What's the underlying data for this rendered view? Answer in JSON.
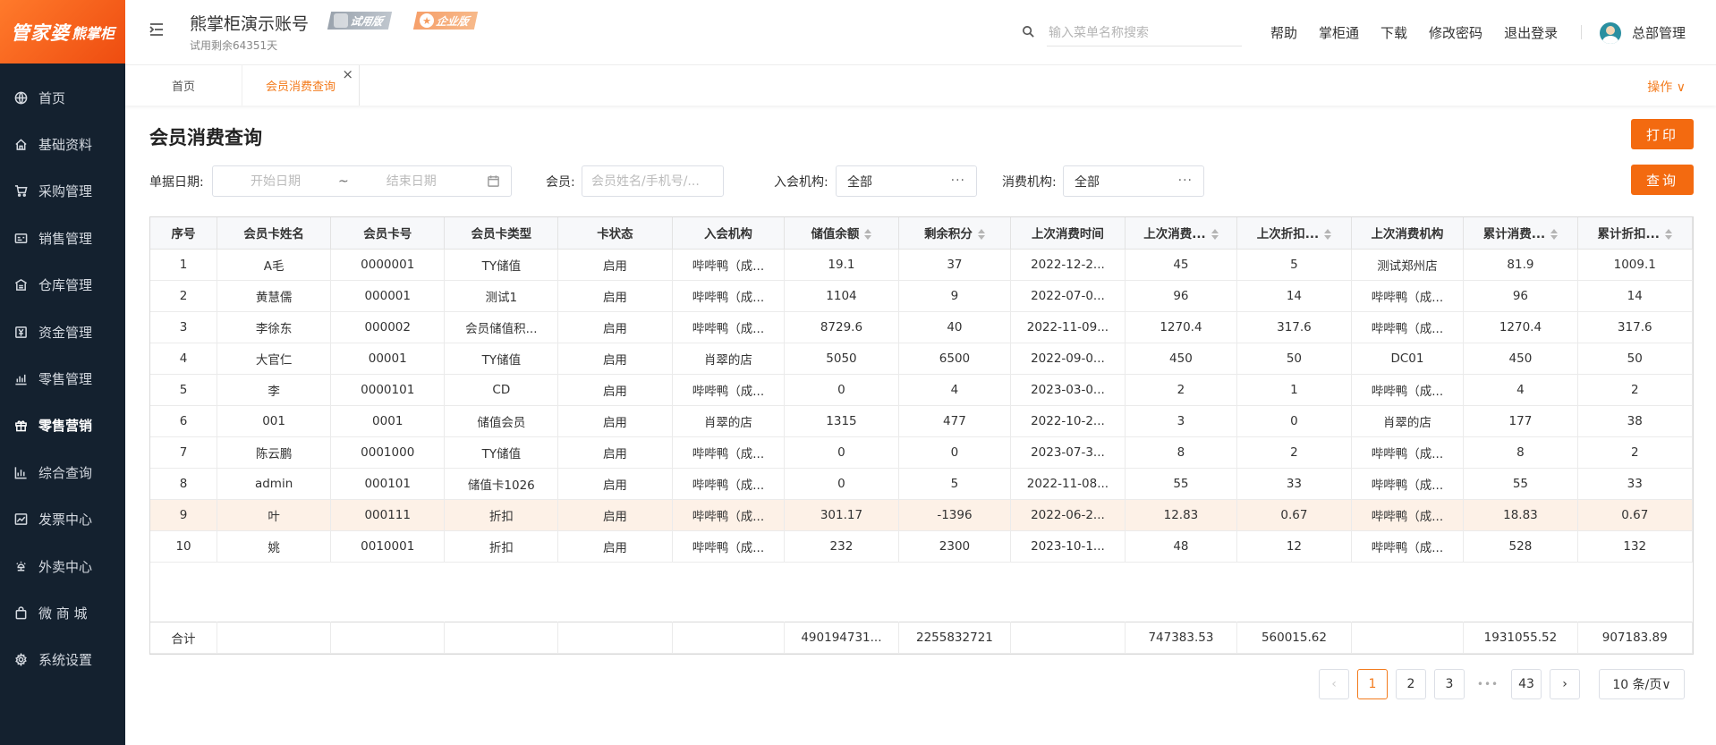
{
  "brand": {
    "logo_main": "管家婆",
    "logo_sub": "熊掌柜"
  },
  "sidebar": {
    "items": [
      {
        "label": "首页",
        "icon": "globe-icon"
      },
      {
        "label": "基础资料",
        "icon": "home-icon"
      },
      {
        "label": "采购管理",
        "icon": "cart-icon"
      },
      {
        "label": "销售管理",
        "icon": "sales-icon"
      },
      {
        "label": "仓库管理",
        "icon": "warehouse-icon"
      },
      {
        "label": "资金管理",
        "icon": "money-icon"
      },
      {
        "label": "零售管理",
        "icon": "chart-icon"
      },
      {
        "label": "零售营销",
        "icon": "gift-icon"
      },
      {
        "label": "综合查询",
        "icon": "bar-chart-icon"
      },
      {
        "label": "发票中心",
        "icon": "trend-icon"
      },
      {
        "label": "外卖中心",
        "icon": "delivery-icon"
      },
      {
        "label": "微 商 城",
        "icon": "shop-icon"
      },
      {
        "label": "系统设置",
        "icon": "gear-icon"
      }
    ]
  },
  "header": {
    "account_name": "熊掌柜演示账号",
    "badge_trial": "试用版",
    "badge_enterprise": "企业版",
    "trial_left": "试用剩余64351天",
    "search_placeholder": "输入菜单名称搜索",
    "links": [
      "帮助",
      "掌柜通",
      "下载",
      "修改密码",
      "退出登录"
    ],
    "user_name": "总部管理"
  },
  "tabs": {
    "home": "首页",
    "active": "会员消费查询",
    "ops": "操作 ∨"
  },
  "page": {
    "title": "会员消费查询",
    "print_label": "打印",
    "query_label": "查询",
    "filters": {
      "date_label": "单据日期:",
      "date_start_placeholder": "开始日期",
      "date_sep": "~",
      "date_end_placeholder": "结束日期",
      "member_label": "会员:",
      "member_placeholder": "会员姓名/手机号/...",
      "join_org_label": "入会机构:",
      "join_org_value": "全部",
      "consume_org_label": "消费机构:",
      "consume_org_value": "全部"
    }
  },
  "table": {
    "columns": [
      "序号",
      "会员卡姓名",
      "会员卡号",
      "会员卡类型",
      "卡状态",
      "入会机构",
      "储值余额",
      "剩余积分",
      "上次消费时间",
      "上次消费...",
      "上次折扣...",
      "上次消费机构",
      "累计消费...",
      "累计折扣..."
    ],
    "rows": [
      [
        "1",
        "A毛",
        "0000001",
        "TY储值",
        "启用",
        "哔哔鸭（成...",
        "19.1",
        "37",
        "2022-12-2...",
        "45",
        "5",
        "测试郑州店",
        "81.9",
        "1009.1"
      ],
      [
        "2",
        "黄慧儒",
        "000001",
        "测试1",
        "启用",
        "哔哔鸭（成...",
        "1104",
        "9",
        "2022-07-0...",
        "96",
        "14",
        "哔哔鸭（成...",
        "96",
        "14"
      ],
      [
        "3",
        "李徐东",
        "000002",
        "会员储值积...",
        "启用",
        "哔哔鸭（成...",
        "8729.6",
        "40",
        "2022-11-09...",
        "1270.4",
        "317.6",
        "哔哔鸭（成...",
        "1270.4",
        "317.6"
      ],
      [
        "4",
        "大官仁",
        "00001",
        "TY储值",
        "启用",
        "肖翠的店",
        "5050",
        "6500",
        "2022-09-0...",
        "450",
        "50",
        "DC01",
        "450",
        "50"
      ],
      [
        "5",
        "李",
        "0000101",
        "CD",
        "启用",
        "哔哔鸭（成...",
        "0",
        "4",
        "2023-03-0...",
        "2",
        "1",
        "哔哔鸭（成...",
        "4",
        "2"
      ],
      [
        "6",
        "001",
        "0001",
        "储值会员",
        "启用",
        "肖翠的店",
        "1315",
        "477",
        "2022-10-2...",
        "3",
        "0",
        "肖翠的店",
        "177",
        "38"
      ],
      [
        "7",
        "陈云鹏",
        "0001000",
        "TY储值",
        "启用",
        "哔哔鸭（成...",
        "0",
        "0",
        "2023-07-3...",
        "8",
        "2",
        "哔哔鸭（成...",
        "8",
        "2"
      ],
      [
        "8",
        "admin",
        "000101",
        "储值卡1026",
        "启用",
        "哔哔鸭（成...",
        "0",
        "5",
        "2022-11-08...",
        "55",
        "33",
        "哔哔鸭（成...",
        "55",
        "33"
      ],
      [
        "9",
        "叶",
        "000111",
        "折扣",
        "启用",
        "哔哔鸭（成...",
        "301.17",
        "-1396",
        "2022-06-2...",
        "12.83",
        "0.67",
        "哔哔鸭（成...",
        "18.83",
        "0.67"
      ],
      [
        "10",
        "姚",
        "0010001",
        "折扣",
        "启用",
        "哔哔鸭（成...",
        "232",
        "2300",
        "2023-10-1...",
        "48",
        "12",
        "哔哔鸭（成...",
        "528",
        "132"
      ]
    ],
    "highlight_row": 9,
    "totals": [
      "合计",
      "",
      "",
      "",
      "",
      "",
      "490194731...",
      "2255832721",
      "",
      "747383.53",
      "560015.62",
      "",
      "1931055.52",
      "907183.89"
    ]
  },
  "pagination": {
    "prev": "‹",
    "next": "›",
    "pages": [
      "1",
      "2",
      "3"
    ],
    "more": "•••",
    "last": "43",
    "current": "1",
    "page_size": "10 条/页∨"
  },
  "colors": {
    "accent": "#f36a10",
    "sidebar_bg": "#14212f"
  }
}
